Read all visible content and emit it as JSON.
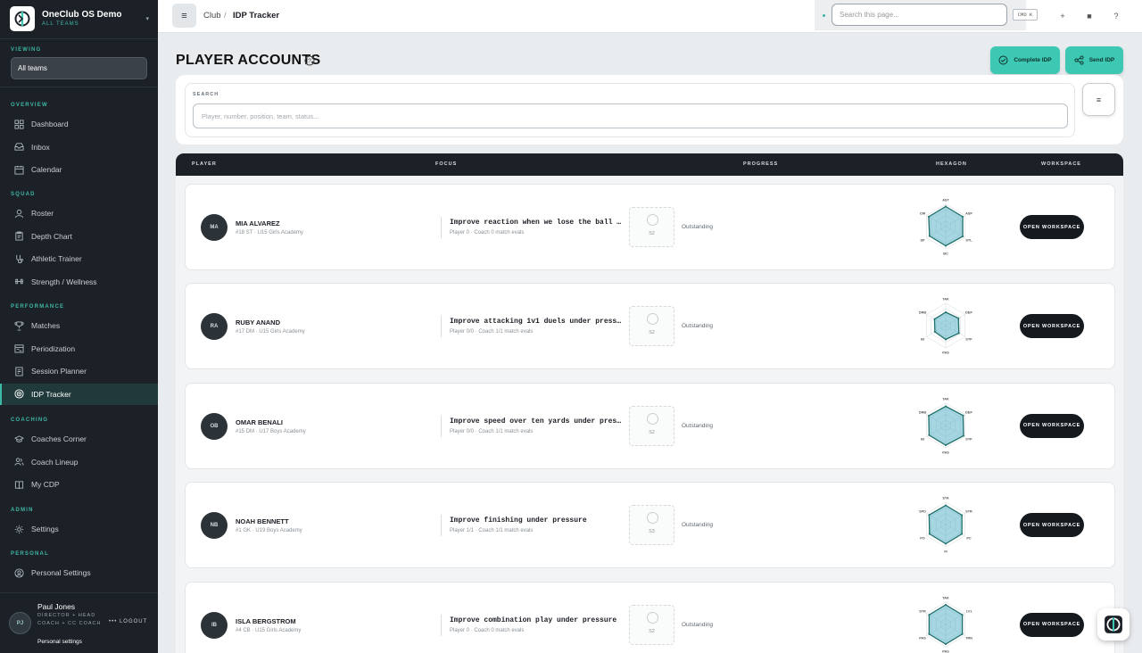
{
  "app": {
    "name": "OneClub OS Demo",
    "scope": "ALL TEAMS"
  },
  "sidebar": {
    "viewing_label": "VIEWING",
    "team_select": "All teams",
    "sections": [
      {
        "label": "OVERVIEW",
        "items": [
          {
            "label": "Dashboard",
            "icon": "grid-icon"
          },
          {
            "label": "Inbox",
            "icon": "inbox-icon"
          },
          {
            "label": "Calendar",
            "icon": "calendar-icon"
          }
        ]
      },
      {
        "label": "SQUAD",
        "items": [
          {
            "label": "Roster",
            "icon": "user-icon"
          },
          {
            "label": "Depth Chart",
            "icon": "clipboard-icon"
          },
          {
            "label": "Athletic Trainer",
            "icon": "stethoscope-icon"
          },
          {
            "label": "Strength / Wellness",
            "icon": "dumbbell-icon"
          }
        ]
      },
      {
        "label": "PERFORMANCE",
        "items": [
          {
            "label": "Matches",
            "icon": "trophy-icon"
          },
          {
            "label": "Periodization",
            "icon": "calendar-range-icon"
          },
          {
            "label": "Session Planner",
            "icon": "notes-icon"
          },
          {
            "label": "IDP Tracker",
            "icon": "target-icon",
            "active": true
          }
        ]
      },
      {
        "label": "COACHING",
        "items": [
          {
            "label": "Coaches Corner",
            "icon": "grad-cap-icon"
          },
          {
            "label": "Coach Lineup",
            "icon": "users-icon"
          },
          {
            "label": "My CDP",
            "icon": "book-icon"
          }
        ]
      },
      {
        "label": "ADMIN",
        "items": [
          {
            "label": "Settings",
            "icon": "gear-icon"
          }
        ]
      },
      {
        "label": "PERSONAL",
        "items": [
          {
            "label": "Personal Settings",
            "icon": "user-circle-icon"
          }
        ]
      }
    ],
    "user": {
      "initials": "PJ",
      "name": "Paul Jones",
      "role": "DIRECTOR + HEAD COACH + CC COACH",
      "logout": "LOGOUT",
      "settings_link": "Personal settings"
    }
  },
  "topbar": {
    "breadcrumb_root": "Club",
    "breadcrumb_sep": "/",
    "breadcrumb_current": "IDP Tracker",
    "search_placeholder": "Search this page...",
    "shortcut": "CMD K",
    "icons": [
      "plus-icon",
      "square-icon",
      "help-icon"
    ]
  },
  "page": {
    "title": "PLAYER ACCOUNTS",
    "complete_btn": "Complete IDP",
    "send_btn": "Send IDP",
    "search_label": "SEARCH",
    "search_placeholder": "Player, number, position, team, status..."
  },
  "table": {
    "headers": {
      "player": "PLAYER",
      "focus": "FOCUS",
      "progress": "PROGRESS",
      "hexagon": "HEXAGON",
      "workspace": "WORKSPACE"
    },
    "workspace_btn": "OPEN WORKSPACE",
    "rows": [
      {
        "initials": "MA",
        "name": "MIA ALVAREZ",
        "meta": "#18 ST · U15 Girls Academy",
        "focus": "Improve reaction when we lose the ball in transition",
        "focus_sub": "Player 0 · Coach 0 match evals",
        "progress": "S2",
        "status": "Outstanding",
        "axes": [
          "AST",
          "ASP",
          "STL",
          "BC",
          "SP",
          "CIR"
        ],
        "values": [
          0.9,
          0.88,
          0.88,
          0.86,
          0.84,
          0.88
        ]
      },
      {
        "initials": "RA",
        "name": "RUBY ANAND",
        "meta": "#17 DM · U15 Girls Academy",
        "focus": "Improve attacking 1v1 duels under pressure",
        "focus_sub": "Player 0/0 · Coach 1/1 match evals",
        "progress": "S2",
        "status": "Outstanding",
        "axes": [
          "TAK",
          "DEP",
          "STP",
          "PAS",
          "BI",
          "DRB"
        ],
        "values": [
          0.6,
          0.66,
          0.68,
          0.62,
          0.56,
          0.58
        ]
      },
      {
        "initials": "OB",
        "name": "OMAR BENALI",
        "meta": "#15 DM · U17 Boys Academy",
        "focus": "Improve speed over ten yards under pressure",
        "focus_sub": "Player 0/0 · Coach 1/1 match evals",
        "progress": "S2",
        "status": "Outstanding",
        "axes": [
          "TAK",
          "DEP",
          "STP",
          "PAS",
          "BI",
          "DRB"
        ],
        "values": [
          0.86,
          0.9,
          0.92,
          0.88,
          0.86,
          0.88
        ]
      },
      {
        "initials": "NB",
        "name": "NOAH BENNETT",
        "meta": "#1 GK · U19 Boys Academy",
        "focus": "Improve finishing under pressure",
        "focus_sub": "Player 1/1 · Coach 1/1 match evals",
        "progress": "S3",
        "status": "Outstanding",
        "axes": [
          "STA",
          "STR",
          "PC",
          "FI",
          "PO",
          "SPD"
        ],
        "values": [
          0.86,
          0.84,
          0.84,
          0.86,
          0.84,
          0.86
        ]
      },
      {
        "initials": "IB",
        "name": "ISLA BERGSTROM",
        "meta": "#4 CB · U15 Girls Academy",
        "focus": "Improve combination play under pressure",
        "focus_sub": "Player 0 · Coach 0 match evals",
        "progress": "S2",
        "status": "Outstanding",
        "axes": [
          "TAK",
          "1V1",
          "TRN",
          "PAS",
          "PAS",
          "STR"
        ],
        "values": [
          0.88,
          0.86,
          0.86,
          0.88,
          0.86,
          0.86
        ]
      }
    ]
  },
  "colors": {
    "sidebar_bg": "#1b2127",
    "accent": "#3cc8b3",
    "radar_fill": "#5bb4c9",
    "radar_stroke": "#1f6f6a"
  }
}
